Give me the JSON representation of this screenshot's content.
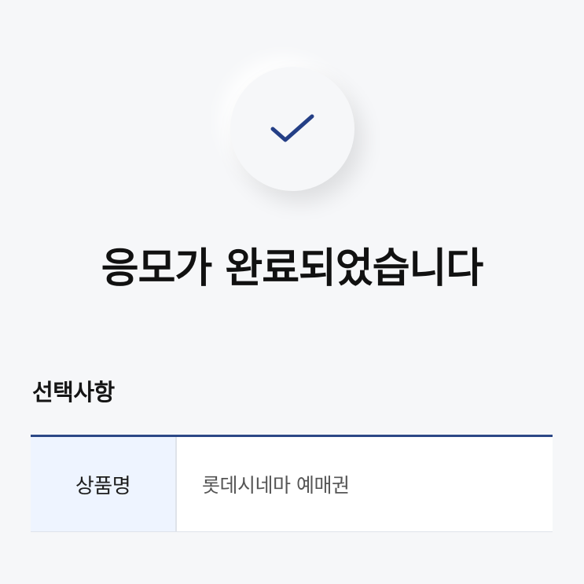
{
  "status": {
    "icon": "check-icon",
    "title": "응모가 완료되었습니다"
  },
  "selection": {
    "section_title": "선택사항",
    "rows": [
      {
        "label": "상품명",
        "value": "롯데시네마 예매권"
      }
    ]
  },
  "colors": {
    "background": "#f6f7f9",
    "check": "#243f86",
    "table_header_border": "#2c4886",
    "label_cell_background": "#eef4ff"
  }
}
